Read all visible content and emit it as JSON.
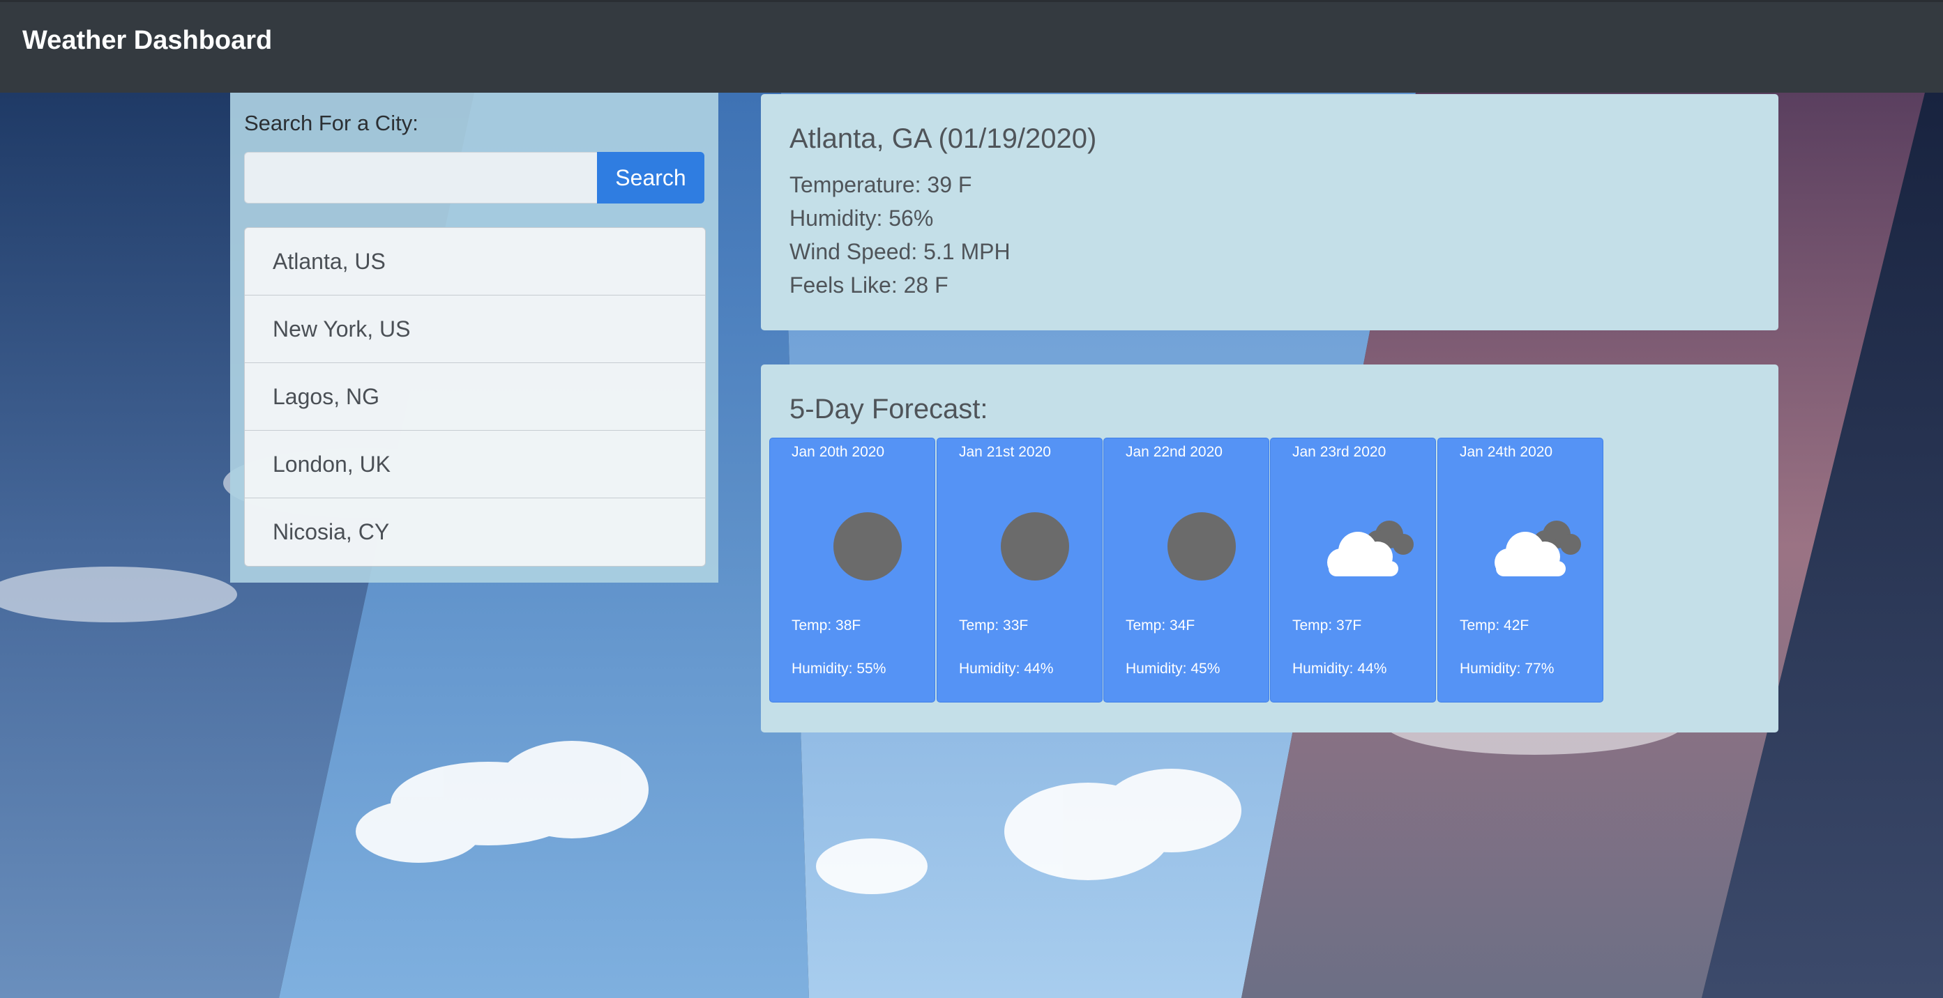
{
  "app": {
    "title": "Weather Dashboard"
  },
  "search": {
    "label": "Search For a City:",
    "input_value": "",
    "button_label": "Search"
  },
  "history": [
    {
      "label": "Atlanta, US"
    },
    {
      "label": "New York, US"
    },
    {
      "label": "Lagos, NG"
    },
    {
      "label": "London, UK"
    },
    {
      "label": "Nicosia, CY"
    }
  ],
  "current": {
    "title": "Atlanta, GA (01/19/2020)",
    "temperature": "Temperature: 39 F",
    "humidity": "Humidity: 56%",
    "wind": "Wind Speed: 5.1 MPH",
    "feels_like": "Feels Like: 28 F"
  },
  "forecast": {
    "title": "5-Day Forecast:",
    "days": [
      {
        "date": "Jan 20th 2020",
        "icon": "circle-icon",
        "temp": "Temp: 38F",
        "humidity": "Humidity: 55%"
      },
      {
        "date": "Jan 21st 2020",
        "icon": "circle-icon",
        "temp": "Temp: 33F",
        "humidity": "Humidity: 44%"
      },
      {
        "date": "Jan 22nd 2020",
        "icon": "circle-icon",
        "temp": "Temp: 34F",
        "humidity": "Humidity: 45%"
      },
      {
        "date": "Jan 23rd 2020",
        "icon": "cloud-icon",
        "temp": "Temp: 37F",
        "humidity": "Humidity: 44%"
      },
      {
        "date": "Jan 24th 2020",
        "icon": "cloud-icon",
        "temp": "Temp: 42F",
        "humidity": "Humidity: 77%"
      }
    ]
  },
  "colors": {
    "navbar": "#343a40",
    "button": "#2f7de1",
    "forecast_card": "#5593f5",
    "panel": "#c4dfe8"
  }
}
